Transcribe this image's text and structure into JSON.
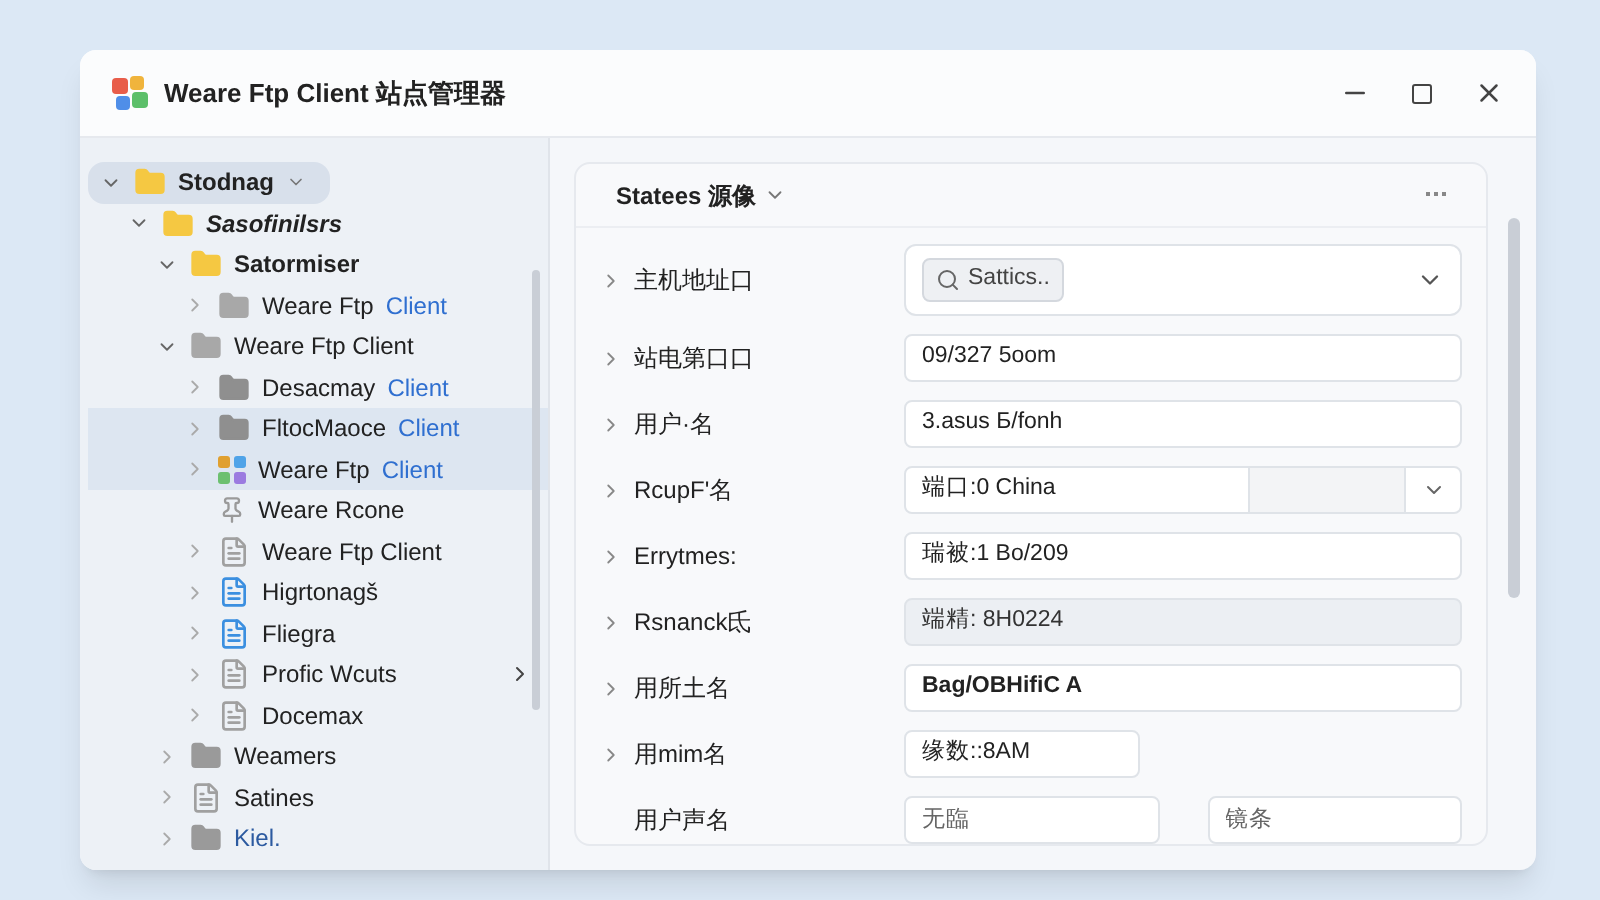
{
  "window": {
    "title": "Weare Ftp Client 站点管理器"
  },
  "tree": [
    {
      "label": "Stodnag",
      "kind": "folder",
      "color": "#f5c842",
      "expanded": true,
      "selected": true,
      "children": [
        {
          "label": "Sasofinilsrs",
          "kind": "folder",
          "color": "#f5c842",
          "expanded": true,
          "selected": false,
          "children": [
            {
              "label": "Satormiser",
              "kind": "folder",
              "color": "#f5c842",
              "expanded": true,
              "selected": false,
              "children": [
                {
                  "label": "Weare Ftp",
                  "accent": "Client",
                  "kind": "folder",
                  "color": "#a8a8a8",
                  "expanded": false,
                  "selected": false
                }
              ]
            },
            {
              "label": "Weare Ftp Client",
              "kind": "folder",
              "color": "#a8a8a8",
              "expanded": true,
              "selected": false,
              "children": [
                {
                  "label": "Desacmay",
                  "accent": "Client",
                  "kind": "folder",
                  "color": "#8f8f8f",
                  "expanded": false,
                  "selected": false
                },
                {
                  "label": "FltocMaoce",
                  "accent": "Client",
                  "kind": "folder",
                  "color": "#8f8f8f",
                  "expanded": false,
                  "selected": true
                },
                {
                  "label": "Weare Ftp",
                  "accent": "Client",
                  "kind": "app",
                  "color": "#e0a030",
                  "expanded": false,
                  "selected": true
                },
                {
                  "label": "Weare Rcone",
                  "kind": "pin",
                  "color": "#9a9a9a",
                  "selected": false
                },
                {
                  "label": "Weare Ftp Client",
                  "kind": "document",
                  "color": "#a0a0a0",
                  "expanded": false,
                  "selected": false
                },
                {
                  "label": "Higrtonagš",
                  "kind": "document",
                  "color": "#3b8fe0",
                  "expanded": false,
                  "selected": false
                },
                {
                  "label": "Fliegra",
                  "kind": "document",
                  "color": "#3b8fe0",
                  "expanded": false,
                  "selected": false
                },
                {
                  "label": "Profic Wcuts",
                  "kind": "document",
                  "color": "#a0a0a0",
                  "expanded": false,
                  "selected": false,
                  "more": true
                },
                {
                  "label": "Docemax",
                  "kind": "document",
                  "color": "#a0a0a0",
                  "expanded": false,
                  "selected": false
                }
              ]
            },
            {
              "label": "Weamers",
              "kind": "folder",
              "color": "#9a9a9a",
              "expanded": false,
              "selected": false
            },
            {
              "label": "Satines",
              "kind": "document",
              "color": "#a0a0a0",
              "expanded": false,
              "selected": false
            },
            {
              "label": "Kiel.",
              "kind": "folder",
              "color": "#9a9a9a",
              "expanded": false,
              "selected": false
            }
          ]
        }
      ]
    }
  ],
  "panel": {
    "title": "Statees 源像"
  },
  "form": [
    {
      "label": "主机地址口",
      "arrow": true,
      "kind": "combo",
      "chip": "Sattics.."
    },
    {
      "label": "站电第口口",
      "arrow": true,
      "kind": "text",
      "value": "09/327 5oom"
    },
    {
      "label": "用户·名",
      "arrow": true,
      "kind": "text",
      "value": "3.asus Б/fonh"
    },
    {
      "label": "RcupF'名",
      "arrow": true,
      "kind": "select",
      "value": "端口:0 China"
    },
    {
      "label": "Errytmes:",
      "arrow": true,
      "kind": "text",
      "value": "瑞被:1 Bo/209"
    },
    {
      "label": "Rsnanck氐",
      "arrow": true,
      "kind": "text",
      "value": "端精: 8H0224",
      "disabled": true
    },
    {
      "label": "用所土名",
      "arrow": true,
      "kind": "text",
      "value": "Bag/OBHifiC A",
      "disabled": false
    },
    {
      "label": "用mim名",
      "arrow": true,
      "kind": "short",
      "value": "缘数::8AM"
    },
    {
      "label": "用户声名",
      "arrow": false,
      "kind": "pair",
      "placeholders": [
        "无臨",
        "镜条"
      ]
    }
  ]
}
